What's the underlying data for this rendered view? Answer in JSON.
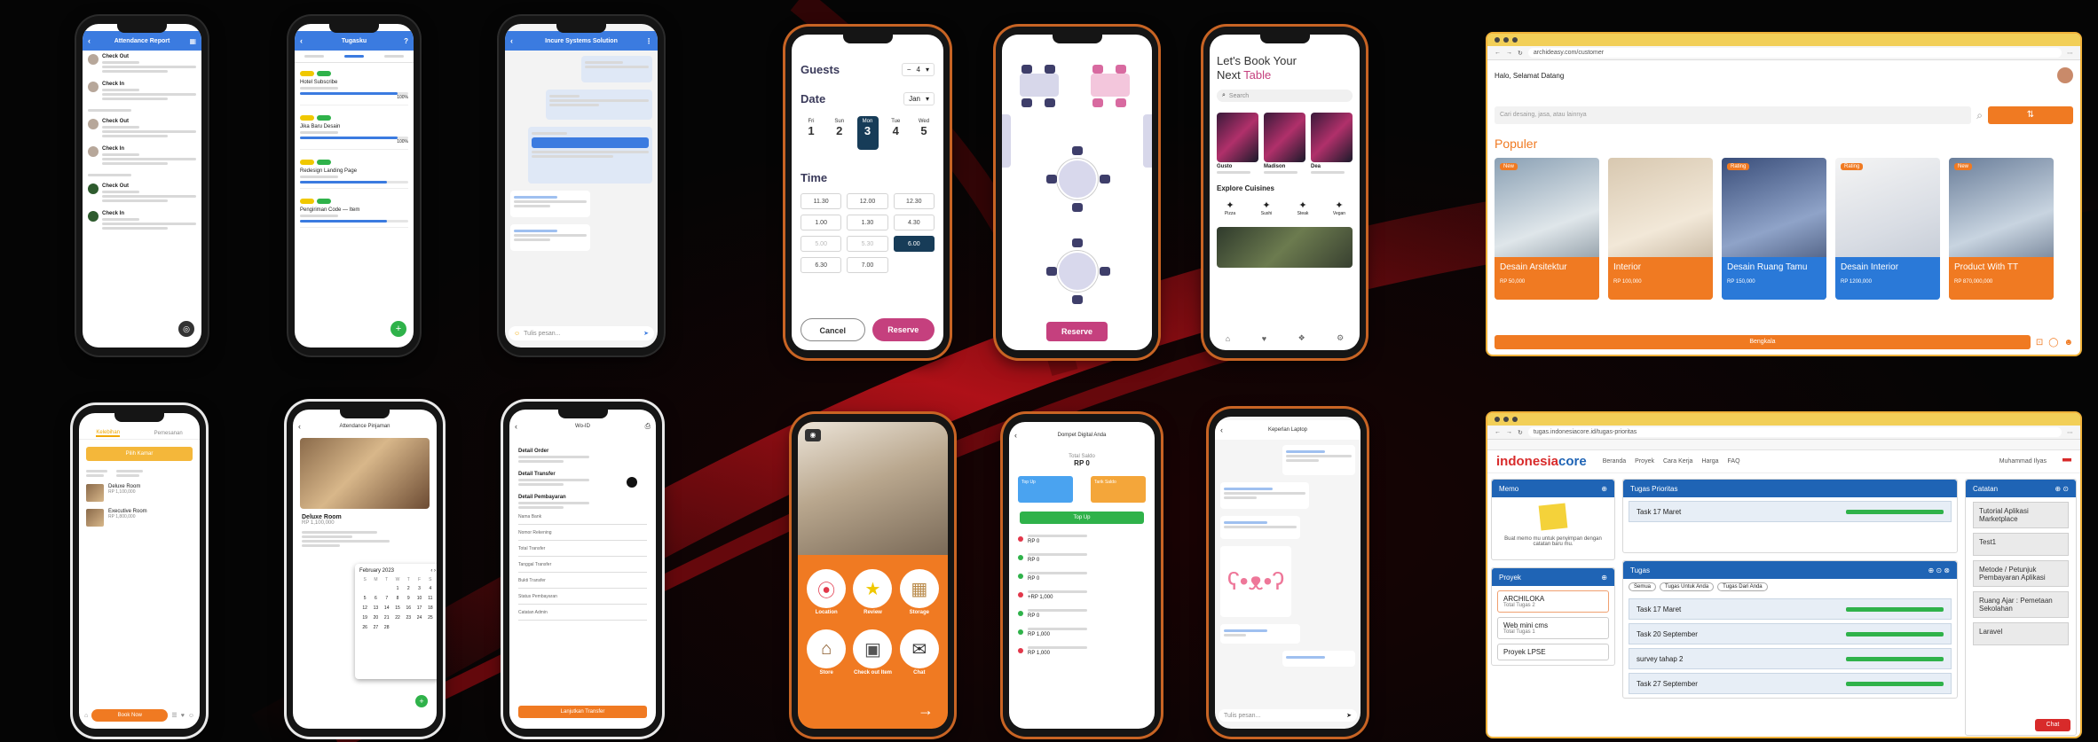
{
  "attendance": {
    "title": "Attendance Report",
    "items": [
      {
        "status": "Check Out",
        "time": "",
        "note": ""
      },
      {
        "status": "Check In",
        "time": "",
        "note": ""
      },
      {
        "status": "Check Out",
        "time": "",
        "note": ""
      },
      {
        "status": "Check In",
        "time": "",
        "note": ""
      },
      {
        "status": "Check Out",
        "time": "",
        "note": ""
      },
      {
        "status": "Check In",
        "time": "",
        "note": ""
      }
    ]
  },
  "tugas": {
    "title": "Tugasku",
    "tabs": [
      "",
      "",
      ""
    ],
    "items": [
      {
        "name": "Hotel Subscribe",
        "pct": "100%"
      },
      {
        "name": "Jika Baru Desain",
        "pct": "100%"
      },
      {
        "name": "Redesign Landing Page",
        "pct": ""
      },
      {
        "name": "Pengiriman Code — Item",
        "pct": ""
      }
    ]
  },
  "chat1": {
    "title": "Incure Systems Solution",
    "placeholder": "Tulis pesan..."
  },
  "guests": {
    "guests_label": "Guests",
    "guests_value": "4",
    "date_label": "Date",
    "month": "Jan",
    "days": [
      {
        "dow": "Fri",
        "num": "1"
      },
      {
        "dow": "Sun",
        "num": "2"
      },
      {
        "dow": "Mon",
        "num": "3"
      },
      {
        "dow": "Tue",
        "num": "4"
      },
      {
        "dow": "Wed",
        "num": "5"
      }
    ],
    "time_label": "Time",
    "times": [
      "11.30",
      "12.00",
      "12.30",
      "1.00",
      "1.30",
      "4.30",
      "5.00",
      "5.30",
      "6.00",
      "6.30",
      "7.00"
    ],
    "cancel": "Cancel",
    "reserve": "Reserve"
  },
  "tables": {
    "reserve": "Reserve"
  },
  "book": {
    "title_line1": "Let's Book Your",
    "title_next": "Next",
    "title_table": "Table",
    "search": "Search",
    "restaurants": [
      {
        "name": "Gusto"
      },
      {
        "name": "Madison"
      },
      {
        "name": "Dea"
      }
    ],
    "explore": "Explore Cuisines",
    "cuisines": [
      "Pizza",
      "Sushi",
      "Steak",
      "Vegan"
    ]
  },
  "web1": {
    "url": "archideasy.com/customer",
    "greeting": "Halo, Selamat Datang",
    "search_placeholder": "Cari desaing, jasa, atau lainnya",
    "section": "Populer",
    "cards": [
      {
        "title": "Desain Arsitektur",
        "price": "RP 50,000",
        "badge": "New"
      },
      {
        "title": "Interior",
        "price": "RP 100,000",
        "badge": ""
      },
      {
        "title": "Desain Ruang Tamu",
        "price": "RP 150,000",
        "badge": "Rating"
      },
      {
        "title": "Desain Interior",
        "price": "RP 1200,000",
        "badge": "Rating"
      },
      {
        "title": "Product With TT",
        "price": "RP 870,000,000",
        "badge": "New"
      }
    ],
    "bottom_btn": "Bengkala"
  },
  "booking": {
    "tab1": "Kelebihan",
    "tab2": "Pemesanan",
    "btn": "Pilih Kamar",
    "rooms": [
      {
        "name": "Deluxe Room",
        "price": "RP 1,100,000"
      },
      {
        "name": "Executive Room",
        "price": "RP 1,800,000"
      }
    ],
    "cta": "Book Now"
  },
  "hotel": {
    "title": "Attendance Pinjaman",
    "room": "Deluxe Room",
    "price": "RP 1,100,000",
    "month": "February 2023",
    "weekdays": [
      "S",
      "M",
      "T",
      "W",
      "T",
      "F",
      "S"
    ],
    "days": [
      "",
      "",
      "",
      "1",
      "2",
      "3",
      "4",
      "5",
      "6",
      "7",
      "8",
      "9",
      "10",
      "11",
      "12",
      "13",
      "14",
      "15",
      "16",
      "17",
      "18",
      "19",
      "20",
      "21",
      "22",
      "23",
      "24",
      "25",
      "26",
      "27",
      "28"
    ]
  },
  "form": {
    "title": "Wo-ID",
    "sections": [
      "Detail Order",
      "Detail Transfer",
      "Detail Pembayaran"
    ],
    "fields": [
      "Nama Bank",
      "Nomor Rekening",
      "Total Transfer",
      "Tanggal Transfer",
      "Bukti Transfer",
      "Status Pembayaran",
      "Catatan Admin"
    ],
    "submit": "Lanjutkan Transfer"
  },
  "grocery": {
    "tiles": [
      "Location",
      "Review",
      "Storage",
      "Store",
      "Check out Item",
      "Chat"
    ]
  },
  "wallet": {
    "title": "Dompet Digital Anda",
    "balance_label": "Total Saldo",
    "balance": "RP 0",
    "top_up": "Top Up",
    "withdraw": "Tarik Saldo",
    "refresh": "Top Up",
    "tx": [
      {
        "amount": "RP 0"
      },
      {
        "amount": "RP 0"
      },
      {
        "amount": "RP 0"
      },
      {
        "amount": "+RP 1,000"
      },
      {
        "amount": "RP 0"
      },
      {
        "amount": "RP 1,000"
      },
      {
        "amount": "RP 1,000"
      }
    ]
  },
  "chat2": {
    "title": "Keperlan Laptop",
    "placeholder": "Tulis pesan..."
  },
  "web2": {
    "url": "tugas.indonesiacore.id/tugas-prioritas",
    "logo1": "indonesia",
    "logo2": "core",
    "nav": [
      "Beranda",
      "Proyek",
      "Cara Kerja",
      "Harga",
      "FAQ"
    ],
    "user": "Muhammad Ilyas",
    "memo_title": "Memo",
    "memo_text": "Buat memo mu untuk penyimpan dengan catatan baru mu.",
    "project_title": "Proyek",
    "projects": [
      {
        "name": "ARCHILOKA",
        "sub": "Total Tugas 2"
      },
      {
        "name": "Web mini cms",
        "sub": "Total Tugas 1"
      },
      {
        "name": "Proyek LPSE",
        "sub": ""
      }
    ],
    "priority_title": "Tugas Prioritas",
    "priority_task": "Task 17 Maret",
    "tasks_title": "Tugas",
    "filters": [
      "Semua",
      "Tugas Untuk Anda",
      "Tugas Dari Anda"
    ],
    "tasks": [
      "Task 17 Maret",
      "Task 20 September",
      "survey tahap 2",
      "Task 27 September"
    ],
    "catatan_title": "Catatan",
    "notes": [
      "Tutorial Aplikasi Marketplace",
      "Test1",
      "Metode / Petunjuk Pembayaran Aplikasi",
      "Ruang Ajar : Pemetaan Sekolahan",
      "Laravel"
    ],
    "chat_btn": "Chat"
  }
}
